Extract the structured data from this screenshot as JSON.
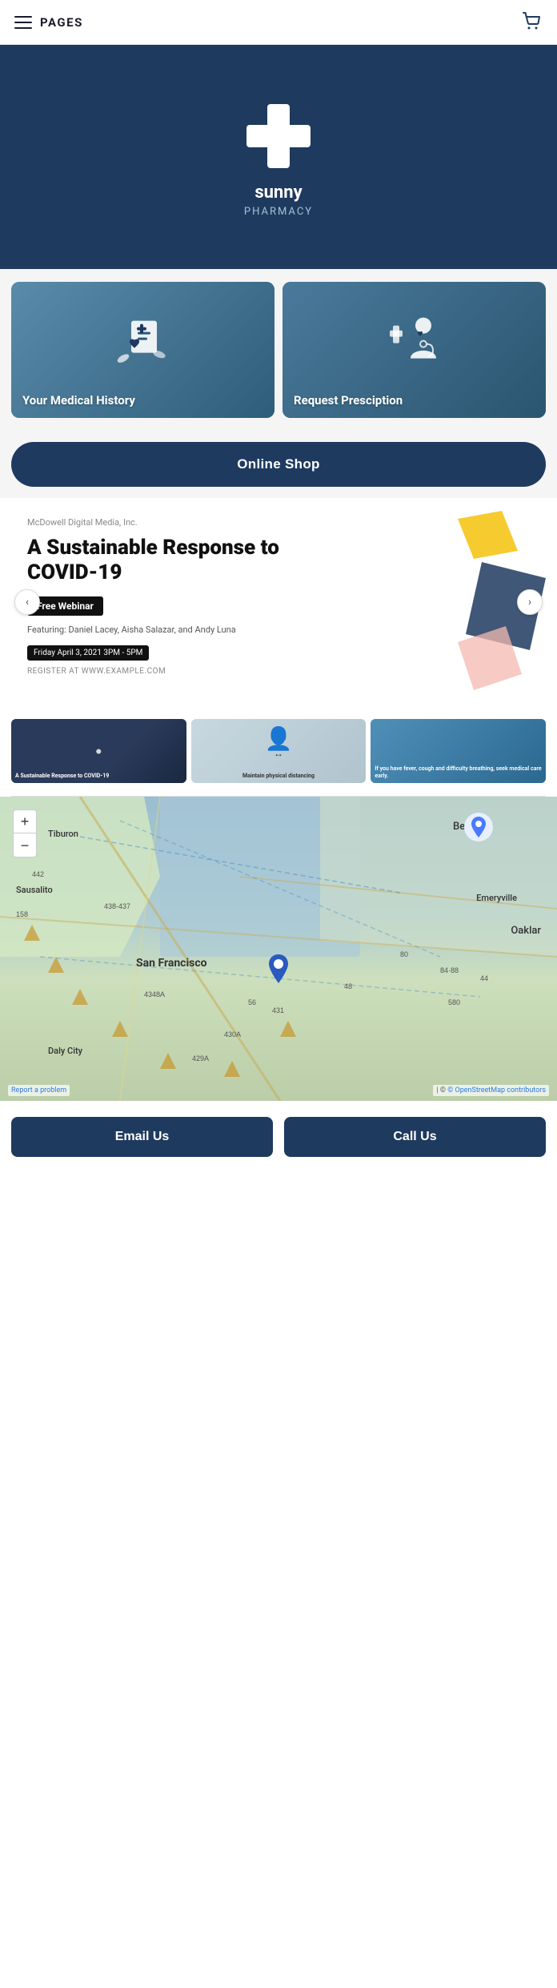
{
  "header": {
    "title": "PAGES",
    "cart_aria": "Shopping cart"
  },
  "hero": {
    "name": "sunny",
    "subtitle": "PHARMACY"
  },
  "cards": [
    {
      "id": "medical-history",
      "label": "Your Medical History"
    },
    {
      "id": "prescription",
      "label": "Request Presciption"
    }
  ],
  "online_shop_btn": "Online Shop",
  "article": {
    "publisher": "McDowell Digital Media, Inc.",
    "title": "A Sustainable Response to COVID-19",
    "badge": "Free Webinar",
    "featuring_label": "Featuring: Daniel Lacey, Aisha Salazar, and Andy Luna",
    "date": "Friday April 3, 2021 3PM - 5PM",
    "register": "REGISTER AT WWW.EXAMPLE.COM"
  },
  "nav_arrows": {
    "left": "‹",
    "right": "›"
  },
  "thumbnails": [
    {
      "id": "thumb-1",
      "bg": "dark",
      "text": "A Sustainable Response to COVID-19"
    },
    {
      "id": "thumb-2",
      "bg": "light",
      "text": "Maintain physical distancing"
    },
    {
      "id": "thumb-3",
      "bg": "blue",
      "text": "If you have fever, cough and difficulty breathing, seek medical care early."
    }
  ],
  "map": {
    "labels": [
      "Tiburon",
      "Sausalito",
      "San Francisco",
      "Daly City",
      "Berkeley",
      "Emeryville",
      "Oaklar"
    ],
    "zoom_in": "+",
    "zoom_out": "−",
    "report_problem": "Report a problem",
    "attribution": "© OpenStreetMap contributors"
  },
  "action_buttons": {
    "email": "Email Us",
    "call": "Call Us"
  }
}
